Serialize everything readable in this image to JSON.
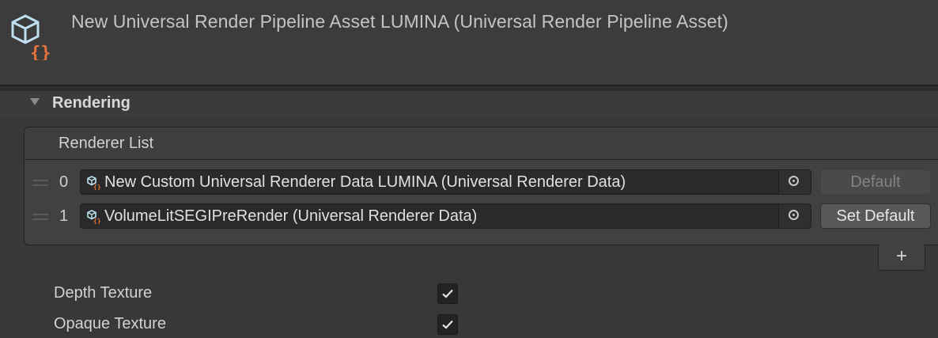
{
  "header": {
    "title": "New Universal Render Pipeline Asset LUMINA (Universal Render Pipeline Asset)",
    "icon": "urp-asset-icon",
    "accent_color": "#e8733a"
  },
  "section": {
    "label": "Rendering",
    "expanded": true
  },
  "renderer_list": {
    "header_label": "Renderer List",
    "items": [
      {
        "index": "0",
        "value": "New Custom Universal Renderer Data LUMINA (Universal Renderer Data)",
        "button_label": "Default",
        "is_default": true
      },
      {
        "index": "1",
        "value": "VolumeLitSEGIPreRender (Universal Renderer Data)",
        "button_label": "Set Default",
        "is_default": false
      }
    ],
    "add_button": "+"
  },
  "properties": [
    {
      "label": "Depth Texture",
      "checked": true
    },
    {
      "label": "Opaque Texture",
      "checked": true
    }
  ]
}
